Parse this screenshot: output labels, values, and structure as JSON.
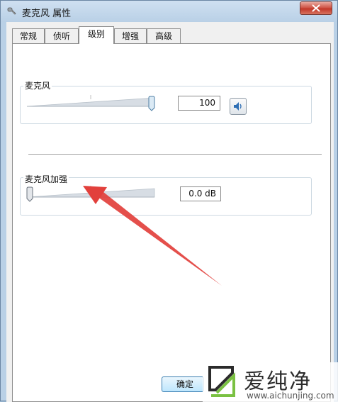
{
  "window": {
    "title": "麦克风 属性",
    "icon": "microphone-icon"
  },
  "tabs": [
    {
      "label": "常规",
      "active": false
    },
    {
      "label": "侦听",
      "active": false
    },
    {
      "label": "级别",
      "active": true
    },
    {
      "label": "增强",
      "active": false
    },
    {
      "label": "高级",
      "active": false
    }
  ],
  "microphone": {
    "label": "麦克风",
    "value": "100",
    "level": 1.0
  },
  "boost": {
    "label": "麦克风加强",
    "value": "0.0 dB",
    "level": 0.0
  },
  "buttons": {
    "ok": "确定"
  },
  "watermark": {
    "text": "爱纯净",
    "url": "www.aichunjing.com"
  },
  "colors": {
    "annotation_arrow": "#e2403c",
    "watermark_green": "#7ac142"
  }
}
